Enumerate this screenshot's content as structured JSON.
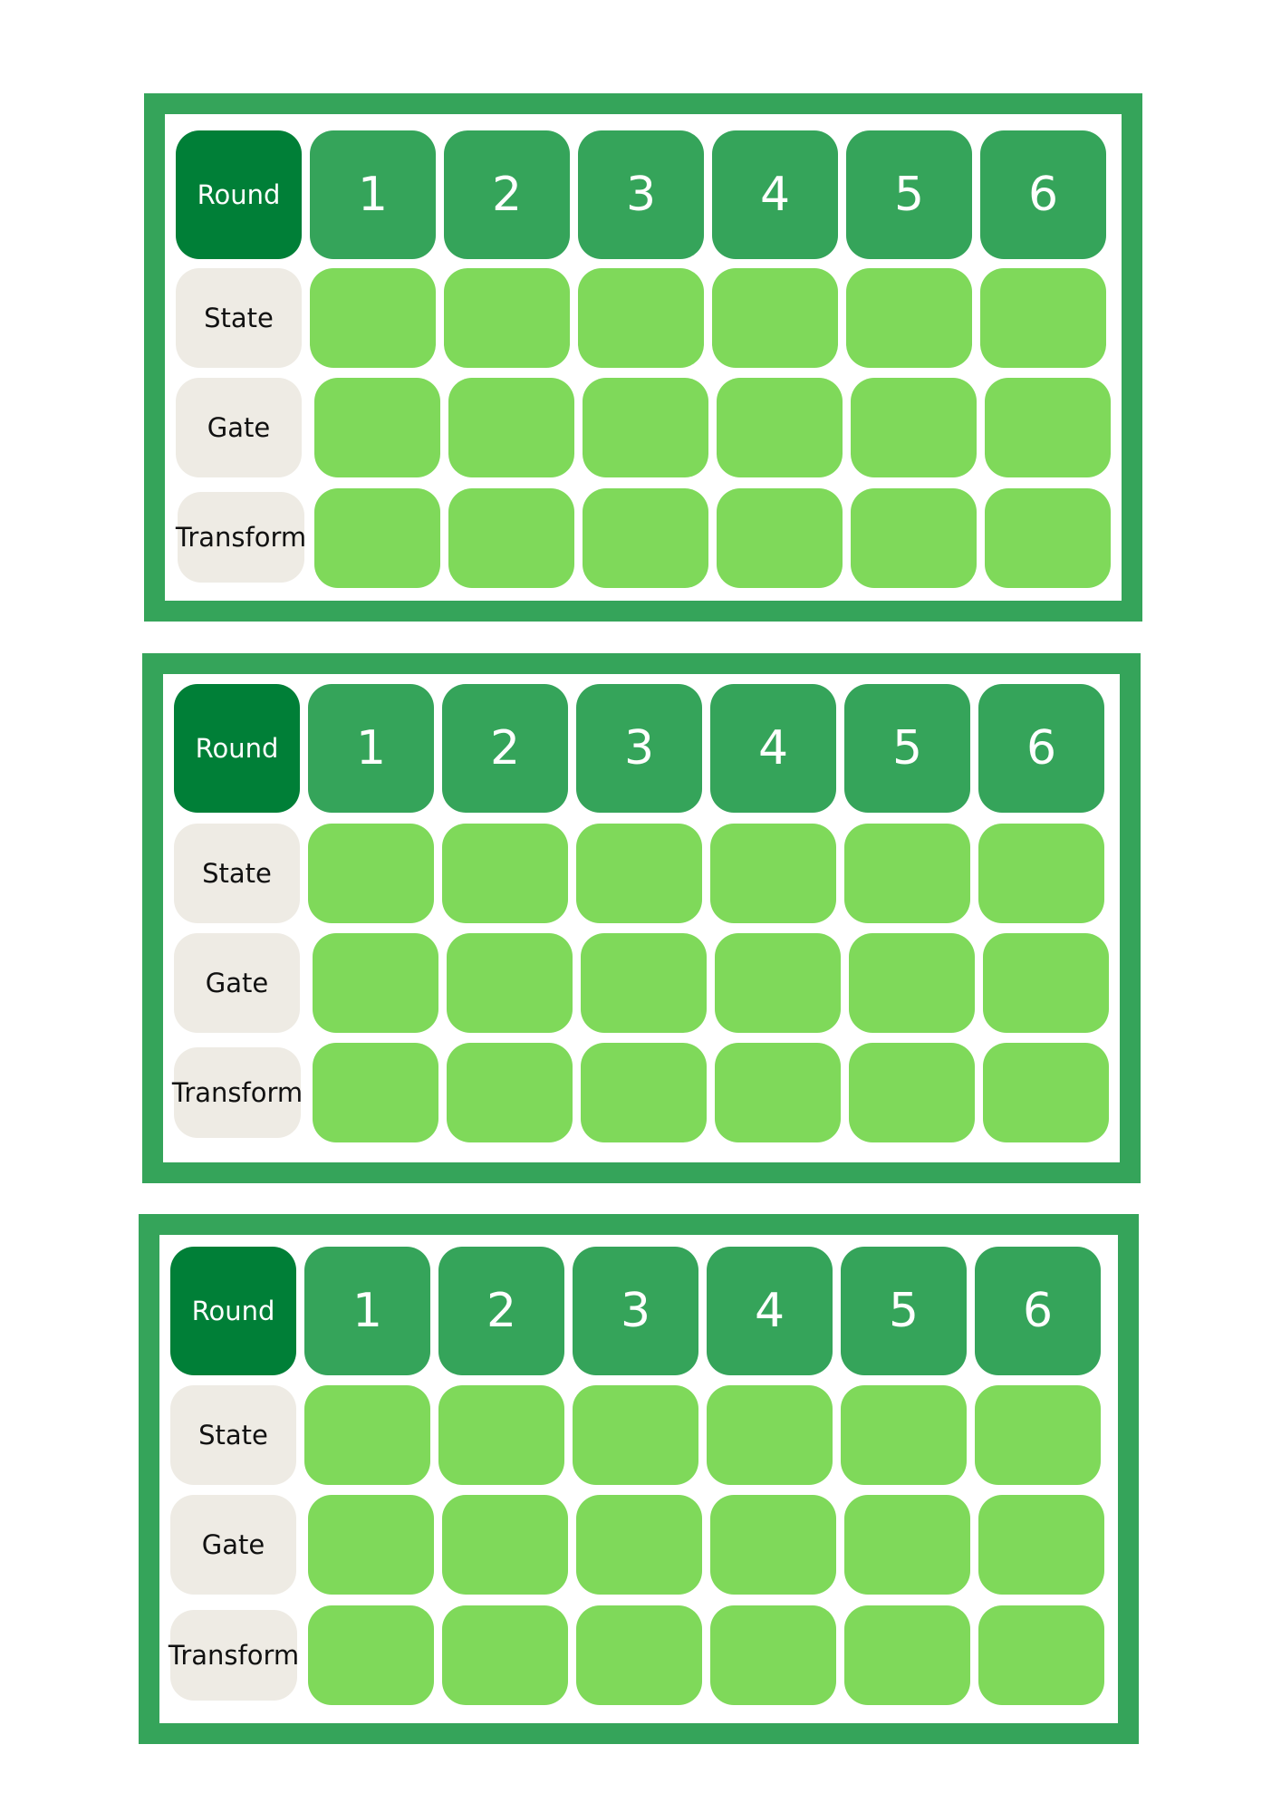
{
  "colors": {
    "frame": "#35a45a",
    "round_label_bg": "#007f37",
    "round_number_bg": "#35a45a",
    "row_label_bg": "#eeebe4",
    "empty_cell_bg": "#7fd95a"
  },
  "cards": [
    {
      "header": {
        "label": "Round",
        "numbers": [
          "1",
          "2",
          "3",
          "4",
          "5",
          "6"
        ]
      },
      "rows": [
        {
          "label": "State"
        },
        {
          "label": "Gate"
        },
        {
          "label": "Transform"
        }
      ]
    },
    {
      "header": {
        "label": "Round",
        "numbers": [
          "1",
          "2",
          "3",
          "4",
          "5",
          "6"
        ]
      },
      "rows": [
        {
          "label": "State"
        },
        {
          "label": "Gate"
        },
        {
          "label": "Transform"
        }
      ]
    },
    {
      "header": {
        "label": "Round",
        "numbers": [
          "1",
          "2",
          "3",
          "4",
          "5",
          "6"
        ]
      },
      "rows": [
        {
          "label": "State"
        },
        {
          "label": "Gate"
        },
        {
          "label": "Transform"
        }
      ]
    }
  ]
}
